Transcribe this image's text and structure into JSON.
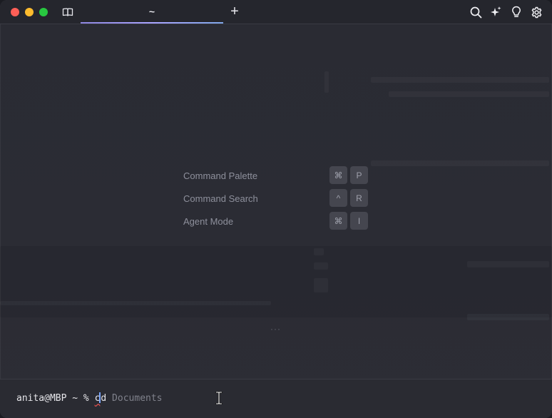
{
  "titlebar": {
    "tab_title": "~",
    "new_tab_label": "+",
    "icons": [
      "sidebar-book-icon",
      "search-icon",
      "sparkle-ai-icon",
      "lightbulb-icon",
      "gear-icon"
    ]
  },
  "shortcuts": [
    {
      "label": "Command Palette",
      "keys": [
        "⌘",
        "P"
      ]
    },
    {
      "label": "Command Search",
      "keys": [
        "^",
        "R"
      ]
    },
    {
      "label": "Agent Mode",
      "keys": [
        "⌘",
        "I"
      ]
    }
  ],
  "more_indicator": "···",
  "input": {
    "prompt": "anita@MBP ~ % ",
    "typed_first": "c",
    "typed_rest": "d",
    "suggestion": " Documents"
  },
  "colors": {
    "accent": "#a9a4ff",
    "cursor": "#79a6ff",
    "close": "#fe5f57",
    "minimize": "#febc2e",
    "maximize": "#28c840"
  }
}
